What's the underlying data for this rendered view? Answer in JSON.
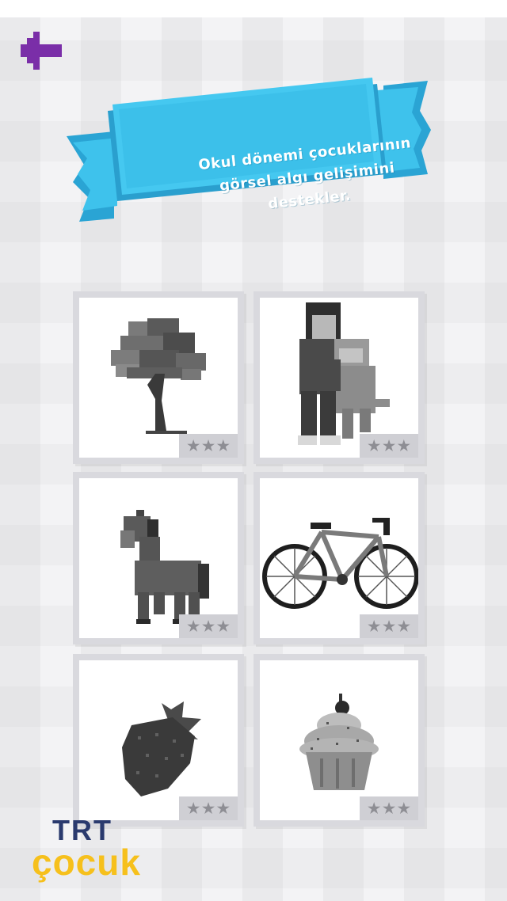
{
  "banner": {
    "line1": "Okul dönemi çocuklarının",
    "line2": "görsel algı gelişimini",
    "line3": "destekler."
  },
  "cards": [
    {
      "name": "tree",
      "rating": "★★★"
    },
    {
      "name": "boy-and-dog",
      "rating": "★★★"
    },
    {
      "name": "horse",
      "rating": "★★★"
    },
    {
      "name": "bicycle",
      "rating": "★★★"
    },
    {
      "name": "strawberry",
      "rating": "★★★"
    },
    {
      "name": "cupcake",
      "rating": "★★★"
    }
  ],
  "logo": {
    "top": "TRT",
    "bottom": "çocuk"
  },
  "colors": {
    "accent": "#7a2ea8",
    "banner": "#3ec2ec",
    "banner_dark": "#2aa4d4",
    "logo_blue": "#2a3a6e",
    "logo_yellow": "#f6c01c"
  },
  "icons": {
    "back": "arrow-left-icon",
    "star": "star-icon"
  }
}
